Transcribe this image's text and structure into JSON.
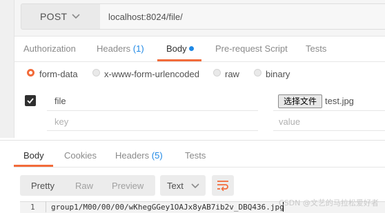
{
  "request": {
    "method": "POST",
    "url": "localhost:8024/file/"
  },
  "request_tabs": {
    "authorization": "Authorization",
    "headers": "Headers",
    "headers_count": "(1)",
    "body": "Body",
    "pre_request": "Pre-request Script",
    "tests": "Tests"
  },
  "body_types": {
    "form_data": "form-data",
    "urlencoded": "x-www-form-urlencoded",
    "raw": "raw",
    "binary": "binary",
    "selected": "form-data"
  },
  "form_rows": {
    "row1": {
      "checked": true,
      "key": "file",
      "file_button": "选择文件",
      "file_name": "test.jpg"
    },
    "row2": {
      "key_placeholder": "key",
      "value_placeholder": "value"
    }
  },
  "response_tabs": {
    "body": "Body",
    "cookies": "Cookies",
    "headers": "Headers",
    "headers_count": "(5)",
    "tests": "Tests"
  },
  "response_view": {
    "pretty": "Pretty",
    "raw": "Raw",
    "preview": "Preview",
    "format": "Text",
    "wrap_icon": "wrap-lines-icon"
  },
  "response_body": {
    "line_number": "1",
    "text": "group1/M00/00/00/wKhegGGey1OAJx8yAB7ib2v_DBQ436.jpg"
  },
  "watermark": "CSDN @文艺的马拉松爱好者",
  "colors": {
    "accent_orange": "#f26b3a",
    "link_blue": "#1e88e5"
  }
}
